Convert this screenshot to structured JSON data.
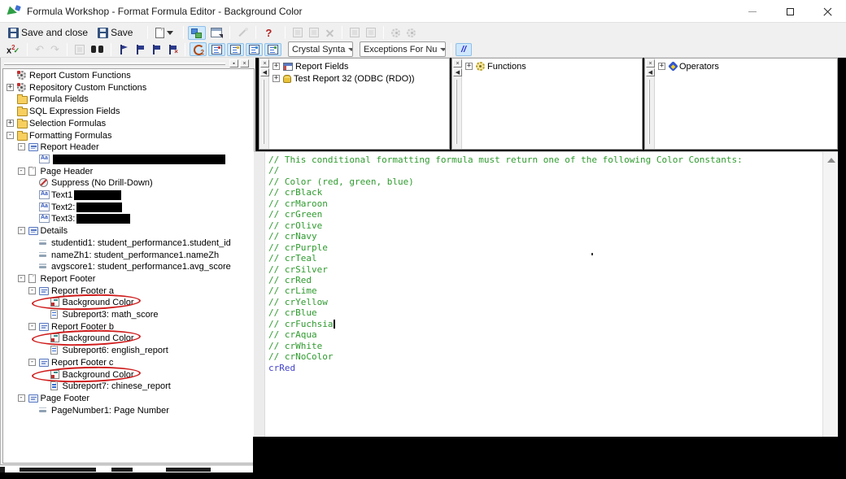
{
  "window": {
    "title": "Formula Workshop - Format Formula Editor - Background Color"
  },
  "toolbar_main": {
    "save_and_close_label": "Save and close",
    "save_label": "Save",
    "help_label": "?"
  },
  "toolbar_editor": {
    "syntax_selector_value": "Crystal Synta",
    "exceptions_selector_value": "Exceptions For Nu",
    "comment_button_label": "//"
  },
  "tree_panel": {
    "items": [
      {
        "label": "Report Custom Functions",
        "level": 0,
        "expand": null,
        "icon": "gear-icon"
      },
      {
        "label": "Repository Custom Functions",
        "level": 0,
        "expand": "plus",
        "icon": "gear-icon"
      },
      {
        "label": "Formula Fields",
        "level": 0,
        "expand": null,
        "icon": "folder-icon"
      },
      {
        "label": "SQL Expression Fields",
        "level": 0,
        "expand": null,
        "icon": "folder-icon"
      },
      {
        "label": "Selection Formulas",
        "level": 0,
        "expand": "plus",
        "icon": "folder-icon"
      },
      {
        "label": "Formatting Formulas",
        "level": 0,
        "expand": "minus",
        "icon": "folder-icon"
      },
      {
        "label": "Report Header",
        "level": 1,
        "expand": "minus",
        "icon": "section-icon"
      },
      {
        "label": "",
        "level": 2,
        "expand": null,
        "icon": "aa-icon",
        "redact_w": 212
      },
      {
        "label": "Page Header",
        "level": 1,
        "expand": "minus",
        "icon": "page-icon"
      },
      {
        "label": "Suppress (No Drill-Down)",
        "level": 2,
        "expand": null,
        "icon": "suppress-icon"
      },
      {
        "label": "Text1",
        "level": 2,
        "expand": null,
        "icon": "aa-icon",
        "redact_w": 58
      },
      {
        "label": "Text2:",
        "level": 2,
        "expand": null,
        "icon": "aa-icon",
        "redact_w": 56
      },
      {
        "label": "Text3:",
        "level": 2,
        "expand": null,
        "icon": "aa-icon",
        "redact_w": 66
      },
      {
        "label": "Details",
        "level": 1,
        "expand": "minus",
        "icon": "section-icon"
      },
      {
        "label": "studentid1: student_performance1.student_id",
        "level": 2,
        "expand": null,
        "icon": "field-icon"
      },
      {
        "label": "nameZh1: student_performance1.nameZh",
        "level": 2,
        "expand": null,
        "icon": "field-icon"
      },
      {
        "label": "avgscore1: student_performance1.avg_score",
        "level": 2,
        "expand": null,
        "icon": "field-icon"
      },
      {
        "label": "Report Footer",
        "level": 1,
        "expand": "minus",
        "icon": "page-icon"
      },
      {
        "label": "Report Footer a",
        "level": 2,
        "expand": "minus",
        "icon": "section-icon"
      },
      {
        "label": "Background Color",
        "level": 3,
        "expand": null,
        "icon": "bgcolor-icon",
        "circled": true
      },
      {
        "label": "Subreport3: math_score",
        "level": 3,
        "expand": null,
        "icon": "subreport-icon"
      },
      {
        "label": "Report Footer b",
        "level": 2,
        "expand": "minus",
        "icon": "section-icon"
      },
      {
        "label": "Background Color",
        "level": 3,
        "expand": null,
        "icon": "bgcolor-icon",
        "circled": true
      },
      {
        "label": "Subreport6: english_report",
        "level": 3,
        "expand": null,
        "icon": "subreport-icon"
      },
      {
        "label": "Report Footer c",
        "level": 2,
        "expand": "minus",
        "icon": "section-icon"
      },
      {
        "label": "Background Color",
        "level": 3,
        "expand": null,
        "icon": "bgcolor-icon",
        "circled": true
      },
      {
        "label": "Subreport7: chinese_report",
        "level": 3,
        "expand": null,
        "icon": "subreport-icon"
      },
      {
        "label": "Page Footer",
        "level": 1,
        "expand": "minus",
        "icon": "section-icon"
      },
      {
        "label": "PageNumber1: Page Number",
        "level": 2,
        "expand": null,
        "icon": "field-icon"
      }
    ]
  },
  "field_panels": [
    {
      "name": "report-fields-panel",
      "rows": [
        {
          "label": "Report Fields",
          "icon": "report-fields-icon"
        },
        {
          "label": "Test Report 32 (ODBC (RDO))",
          "icon": "database-icon"
        }
      ]
    },
    {
      "name": "functions-panel",
      "rows": [
        {
          "label": "Functions",
          "icon": "functions-icon"
        }
      ]
    },
    {
      "name": "operators-panel",
      "rows": [
        {
          "label": "Operators",
          "icon": "operators-icon"
        }
      ]
    }
  ],
  "editor": {
    "lines": [
      {
        "text": "// This conditional formatting formula must return one of the following Color Constants:",
        "kind": "comment"
      },
      {
        "text": "//",
        "kind": "comment"
      },
      {
        "text": "// Color (red, green, blue)",
        "kind": "comment"
      },
      {
        "text": "// crBlack",
        "kind": "comment"
      },
      {
        "text": "// crMaroon",
        "kind": "comment"
      },
      {
        "text": "// crGreen",
        "kind": "comment"
      },
      {
        "text": "// crOlive",
        "kind": "comment"
      },
      {
        "text": "// crNavy",
        "kind": "comment"
      },
      {
        "text": "// crPurple",
        "kind": "comment"
      },
      {
        "text": "// crTeal",
        "kind": "comment"
      },
      {
        "text": "// crSilver",
        "kind": "comment"
      },
      {
        "text": "// crRed",
        "kind": "comment"
      },
      {
        "text": "// crLime",
        "kind": "comment"
      },
      {
        "text": "// crYellow",
        "kind": "comment"
      },
      {
        "text": "// crBlue",
        "kind": "comment"
      },
      {
        "text": "// crFuchsia",
        "kind": "comment",
        "caret": true
      },
      {
        "text": "// crAqua",
        "kind": "comment"
      },
      {
        "text": "// crWhite",
        "kind": "comment"
      },
      {
        "text": "// crNoColor",
        "kind": "comment"
      },
      {
        "text": "crRed",
        "kind": "code"
      }
    ],
    "comment_color": "#2f9b2f",
    "code_color": "#4343cc"
  },
  "annotations": {
    "redaction_color": "#000000",
    "highlight_ellipse_color": "#cf1d1d"
  }
}
